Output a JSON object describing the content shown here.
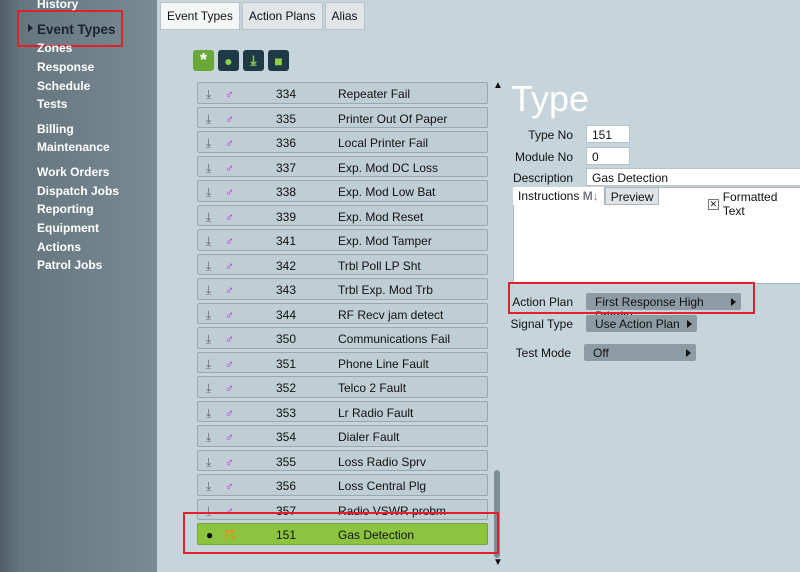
{
  "sidebar": {
    "items": [
      "History",
      "Event Types",
      "Zones",
      "Response",
      "Schedule",
      "Tests",
      "Billing",
      "Maintenance",
      "Work Orders",
      "Dispatch Jobs",
      "Reporting",
      "Equipment",
      "Actions",
      "Patrol Jobs"
    ],
    "active": "Event Types"
  },
  "tabs": [
    "Event Types",
    "Action Plans",
    "Alias"
  ],
  "toolbar": {
    "icons": [
      "asterisk-icon",
      "person-icon",
      "download-icon",
      "puzzle-icon"
    ]
  },
  "list": {
    "rows": [
      {
        "no": "334",
        "desc": "Repeater Fail"
      },
      {
        "no": "335",
        "desc": "Printer Out Of Paper"
      },
      {
        "no": "336",
        "desc": "Local Printer Fail"
      },
      {
        "no": "337",
        "desc": "Exp. Mod DC Loss"
      },
      {
        "no": "338",
        "desc": "Exp. Mod Low Bat"
      },
      {
        "no": "339",
        "desc": "Exp. Mod Reset"
      },
      {
        "no": "341",
        "desc": "Exp. Mod Tamper"
      },
      {
        "no": "342",
        "desc": "Trbl Poll LP Sht"
      },
      {
        "no": "343",
        "desc": "Trbl Exp. Mod Trb"
      },
      {
        "no": "344",
        "desc": "RF Recv jam detect"
      },
      {
        "no": "350",
        "desc": "Communications Fail"
      },
      {
        "no": "351",
        "desc": "Phone Line Fault"
      },
      {
        "no": "352",
        "desc": "Telco 2 Fault"
      },
      {
        "no": "353",
        "desc": "Lr Radio Fault"
      },
      {
        "no": "354",
        "desc": "Dialer Fault"
      },
      {
        "no": "355",
        "desc": "Loss Radio Sprv"
      },
      {
        "no": "356",
        "desc": "Loss Central Plg"
      },
      {
        "no": "357",
        "desc": "Radio VSWR probm"
      }
    ],
    "selected": {
      "no": "151",
      "desc": "Gas Detection"
    }
  },
  "detail": {
    "title": "Type",
    "type_no_label": "Type No",
    "type_no": "151",
    "module_no_label": "Module No",
    "module_no": "0",
    "description_label": "Description",
    "description": "Gas Detection",
    "instructions_tab": "Instructions",
    "md_icon": "M↓",
    "preview_tab": "Preview",
    "formatted_text_label": "Formatted Text",
    "formatted_text_checked": true,
    "action_plan_label": "Action Plan",
    "action_plan": "First Response High Priority",
    "signal_type_label": "Signal Type",
    "signal_type": "Use Action Plan",
    "test_mode_label": "Test Mode",
    "test_mode": "Off"
  },
  "colors": {
    "highlight": "#e0202a",
    "selected_row": "#8dc43f"
  }
}
